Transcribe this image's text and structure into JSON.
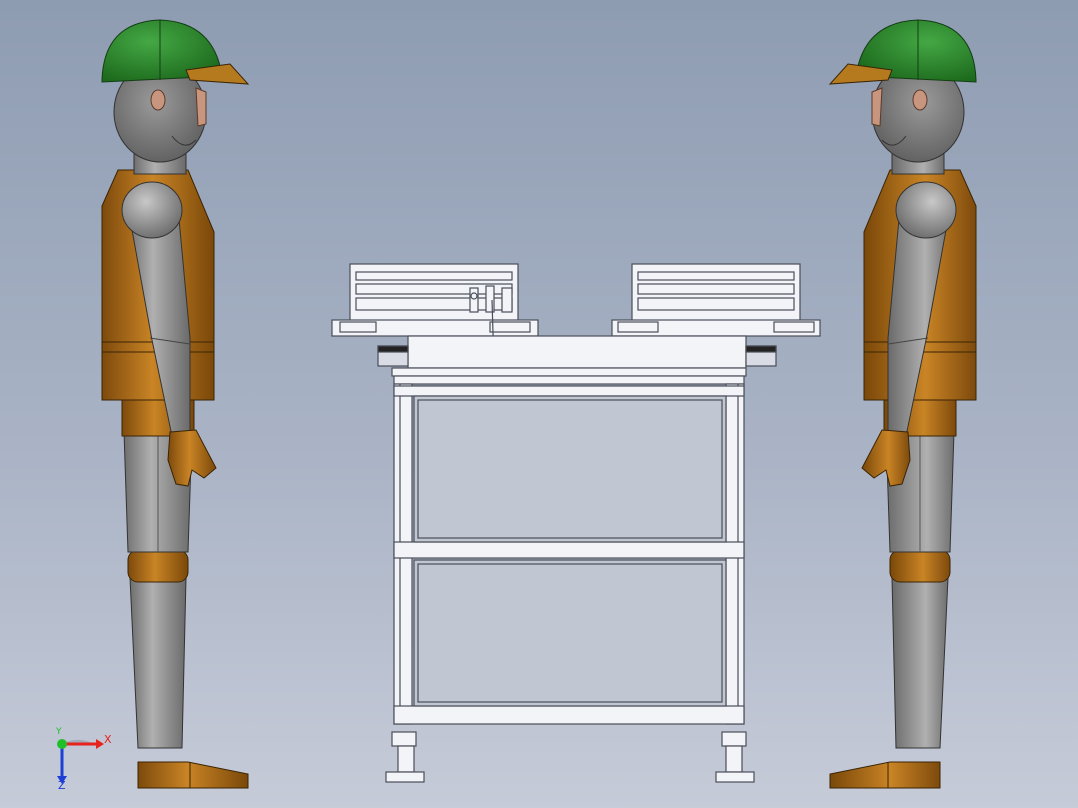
{
  "triad": {
    "x_label": "X",
    "y_label": "Y",
    "z_label": "Z",
    "x_color": "#e8221c",
    "y_color": "#1fbf2a",
    "z_color": "#1d3fd6"
  },
  "colors": {
    "helmet": "#2e8b2e",
    "body_gray": "#8c8c8c",
    "vest_brown": "#b8741a",
    "frame_white": "#f2f4f8",
    "frame_line": "#4a4e58"
  },
  "icons": [
    "axis-triad-icon"
  ]
}
